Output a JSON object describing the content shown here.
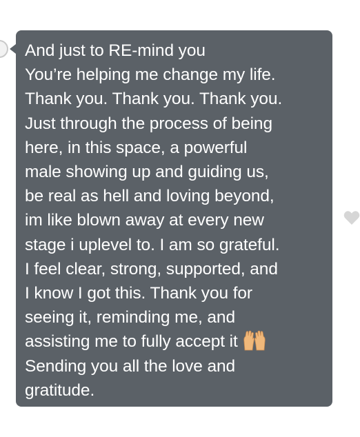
{
  "message": {
    "lines": [
      "And just to RE-mind you",
      "You’re helping me change my life.",
      "Thank you. Thank you. Thank you.",
      "Just through the process of being",
      "here, in this space, a powerful",
      "male showing up and guiding us,",
      "be real as hell and loving beyond,",
      "im like blown away at every new",
      "stage i uplevel to. I am so grateful.",
      "I feel clear, strong, supported, and",
      "I know I got this. Thank you for",
      "seeing it, reminding me, and",
      "assisting me to fully accept it",
      "Sending you all the love and",
      "gratitude."
    ],
    "emoji": "raising-hands-emoji",
    "bubble_color": "#5b6167",
    "text_color": "#ffffff"
  },
  "actions": {
    "like_icon": "heart-icon",
    "like_color": "#d6d6d6"
  }
}
